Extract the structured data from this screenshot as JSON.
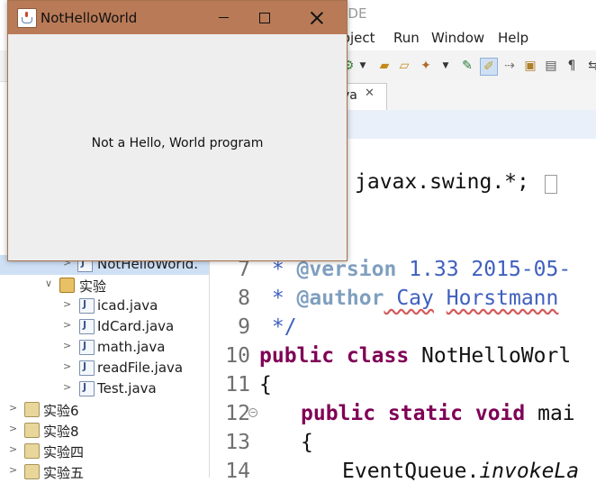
{
  "ide": {
    "title_fragment": "e IDE",
    "menu": [
      "roject",
      "Run",
      "Window",
      "Help"
    ],
    "editor_tab": {
      "label": "va",
      "close": "✕"
    },
    "code": {
      "import_text": "javax.swing.*;",
      "lines": [
        {
          "num": "7"
        },
        {
          "num": "8"
        },
        {
          "num": "9"
        },
        {
          "num": "10"
        },
        {
          "num": "11"
        },
        {
          "num": "12"
        },
        {
          "num": "13"
        },
        {
          "num": "14"
        }
      ],
      "tokens": {
        "l7_star": " * ",
        "l7_tag": "@version",
        "l7_text": " 1.33 2015-05-",
        "l8_star": " * ",
        "l8_tag": "@author",
        "l8_cay": " Cay",
        "l8_sp": " ",
        "l8_horst": "Horstmann",
        "l9": " */",
        "l10_kw": "public class",
        "l10_text": " NotHelloWorl",
        "l11": "{",
        "l12_kw": "public static void",
        "l12_text": " mai",
        "l13": "{",
        "l14_pre": "EventQueue.",
        "l14_it": "invokeLa"
      }
    },
    "explorer": {
      "items": [
        {
          "label": "NotHelloWorld.",
          "kind": "java",
          "selected": true
        },
        {
          "label": "实验",
          "kind": "package"
        },
        {
          "label": "icad.java",
          "kind": "java"
        },
        {
          "label": "IdCard.java",
          "kind": "java"
        },
        {
          "label": "math.java",
          "kind": "java"
        },
        {
          "label": "readFile.java",
          "kind": "java"
        },
        {
          "label": "Test.java",
          "kind": "java"
        },
        {
          "label": "实验6",
          "kind": "folder"
        },
        {
          "label": "实验8",
          "kind": "folder"
        },
        {
          "label": "实验四",
          "kind": "folder"
        },
        {
          "label": "实验五",
          "kind": "folder"
        }
      ]
    }
  },
  "window": {
    "title": "NotHelloWorld",
    "message": "Not a Hello, World program",
    "titlebar_color": "#b97a57"
  }
}
